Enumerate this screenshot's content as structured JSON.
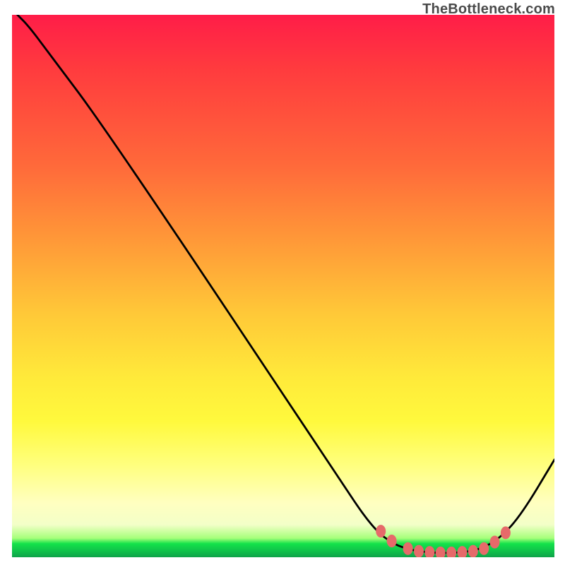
{
  "watermark": "TheBottleneck.com",
  "chart_data": {
    "type": "line",
    "title": "",
    "xlabel": "",
    "ylabel": "",
    "xlim": [
      0,
      100
    ],
    "ylim": [
      0,
      100
    ],
    "curve": [
      {
        "x": 1,
        "y": 100
      },
      {
        "x": 3,
        "y": 98
      },
      {
        "x": 6,
        "y": 94
      },
      {
        "x": 9,
        "y": 90
      },
      {
        "x": 15,
        "y": 82
      },
      {
        "x": 30,
        "y": 60
      },
      {
        "x": 50,
        "y": 30
      },
      {
        "x": 60,
        "y": 15
      },
      {
        "x": 66,
        "y": 6
      },
      {
        "x": 70,
        "y": 2.5
      },
      {
        "x": 74,
        "y": 1.2
      },
      {
        "x": 78,
        "y": 0.8
      },
      {
        "x": 82,
        "y": 0.8
      },
      {
        "x": 86,
        "y": 1.3
      },
      {
        "x": 90,
        "y": 3.5
      },
      {
        "x": 94,
        "y": 8
      },
      {
        "x": 100,
        "y": 18
      }
    ],
    "markers": [
      {
        "x": 68,
        "y": 4.8
      },
      {
        "x": 70,
        "y": 3.0
      },
      {
        "x": 73,
        "y": 1.6
      },
      {
        "x": 75,
        "y": 1.1
      },
      {
        "x": 77,
        "y": 0.9
      },
      {
        "x": 79,
        "y": 0.8
      },
      {
        "x": 81,
        "y": 0.8
      },
      {
        "x": 83,
        "y": 0.9
      },
      {
        "x": 85,
        "y": 1.1
      },
      {
        "x": 87,
        "y": 1.6
      },
      {
        "x": 89,
        "y": 2.8
      },
      {
        "x": 91,
        "y": 4.5
      }
    ],
    "marker_color": "#e66a6a",
    "gradient_stops": [
      {
        "pos": 0,
        "color": "#ff1d48"
      },
      {
        "pos": 50,
        "color": "#ffc838"
      },
      {
        "pos": 80,
        "color": "#fff93d"
      },
      {
        "pos": 97,
        "color": "#13e24a"
      },
      {
        "pos": 100,
        "color": "#0fa14a"
      }
    ]
  }
}
